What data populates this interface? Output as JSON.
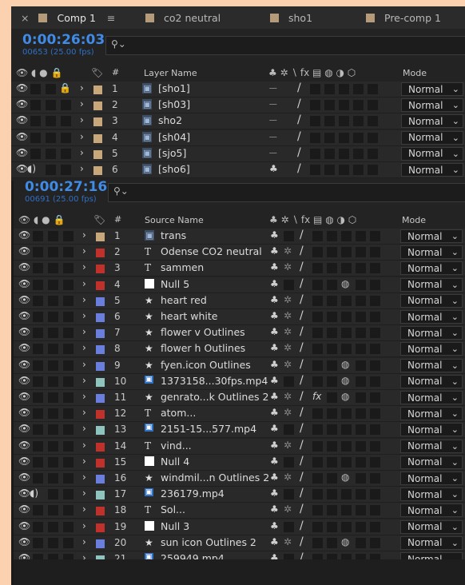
{
  "colors": {
    "bg": "#FBD1B0",
    "timecode": "#3F8BE8",
    "tan": "#C8A87A",
    "red": "#C0312B",
    "blue": "#6A7FDD",
    "teal": "#8FC4BE",
    "tab_tan": "#B59B7A"
  },
  "tabs": [
    {
      "label": "Comp 1",
      "menu": "≡",
      "close": "×"
    },
    {
      "label": "co2 neutral"
    },
    {
      "label": "sho1"
    },
    {
      "label": "Pre-comp 1"
    }
  ],
  "comp1": {
    "timecode": "0:00:26:03",
    "frames": "00653 (25.00 fps)",
    "search_placeholder": "",
    "headers": {
      "num": "#",
      "name": "Layer Name",
      "mode": "Mode"
    },
    "layers": [
      {
        "num": "1",
        "name": "[sho1]",
        "color": "tan",
        "lock": true,
        "mode": "Normal",
        "sw": "dash"
      },
      {
        "num": "2",
        "name": "[sh03]",
        "color": "tan",
        "lock": false,
        "mode": "Normal",
        "sw": "dash"
      },
      {
        "num": "3",
        "name": "sho2",
        "color": "tan",
        "lock": false,
        "mode": "Normal",
        "sw": "dash"
      },
      {
        "num": "4",
        "name": "[sh04]",
        "color": "tan",
        "lock": false,
        "mode": "Normal",
        "sw": "dash"
      },
      {
        "num": "5",
        "name": "[sjo5]",
        "color": "tan",
        "lock": false,
        "mode": "Normal",
        "sw": "dash"
      },
      {
        "num": "6",
        "name": "[sho6]",
        "color": "tan",
        "lock": false,
        "audio": true,
        "mode": "Normal",
        "sw": "shy"
      }
    ]
  },
  "comp2": {
    "timecode": "0:00:27:16",
    "frames": "00691 (25.00 fps)",
    "search_placeholder": "",
    "headers": {
      "num": "#",
      "name": "Source Name",
      "mode": "Mode"
    },
    "layers": [
      {
        "num": "1",
        "name": "trans",
        "color": "tan",
        "type": "comp",
        "mode": "Normal"
      },
      {
        "num": "2",
        "name": "Odense  CO2 neutral",
        "color": "red",
        "type": "text",
        "mode": "Normal",
        "sun": true
      },
      {
        "num": "3",
        "name": "sammen",
        "color": "red",
        "type": "text",
        "mode": "Normal",
        "sun": true
      },
      {
        "num": "4",
        "name": "Null 5",
        "color": "red",
        "type": "null",
        "mode": "Normal",
        "mb": true
      },
      {
        "num": "5",
        "name": "heart red",
        "color": "blue",
        "type": "shape",
        "mode": "Normal",
        "sun": true
      },
      {
        "num": "6",
        "name": "heart white",
        "color": "blue",
        "type": "shape",
        "mode": "Normal",
        "sun": true
      },
      {
        "num": "7",
        "name": "flower v Outlines",
        "color": "blue",
        "type": "shape",
        "mode": "Normal",
        "sun": true
      },
      {
        "num": "8",
        "name": "flower h Outlines",
        "color": "blue",
        "type": "shape",
        "mode": "Normal",
        "sun": true
      },
      {
        "num": "9",
        "name": "fyen.icon Outlines",
        "color": "blue",
        "type": "shape",
        "mode": "Normal",
        "sun": true,
        "mb": true
      },
      {
        "num": "10",
        "name": "1373158...30fps.mp4",
        "color": "teal",
        "type": "footage",
        "mode": "Normal",
        "mb": true
      },
      {
        "num": "11",
        "name": "genrato...k Outlines 2",
        "color": "blue",
        "type": "shape",
        "mode": "Normal",
        "sun": true,
        "fx": true,
        "mb": true
      },
      {
        "num": "12",
        "name": "atom...",
        "color": "red",
        "type": "text",
        "mode": "Normal",
        "sun": true
      },
      {
        "num": "13",
        "name": "2151-15...577.mp4",
        "color": "teal",
        "type": "footage",
        "mode": "Normal"
      },
      {
        "num": "14",
        "name": "vind...",
        "color": "red",
        "type": "text",
        "mode": "Normal",
        "sun": true
      },
      {
        "num": "15",
        "name": "Null 4",
        "color": "red",
        "type": "null",
        "mode": "Normal"
      },
      {
        "num": "16",
        "name": "windmil...n Outlines 2",
        "color": "blue",
        "type": "shape",
        "mode": "Normal",
        "sun": true,
        "mb": true
      },
      {
        "num": "17",
        "name": "236179.mp4",
        "color": "teal",
        "type": "footage",
        "mode": "Normal",
        "audio": true
      },
      {
        "num": "18",
        "name": "Sol...",
        "color": "red",
        "type": "text",
        "mode": "Normal",
        "sun": true
      },
      {
        "num": "19",
        "name": "Null 3",
        "color": "red",
        "type": "null",
        "mode": "Normal"
      },
      {
        "num": "20",
        "name": "sun icon Outlines 2",
        "color": "blue",
        "type": "shape",
        "mode": "Normal",
        "sun": true,
        "mb": true
      },
      {
        "num": "21",
        "name": "259949.mp4",
        "color": "teal",
        "type": "footage",
        "mode": "Normal"
      }
    ]
  }
}
